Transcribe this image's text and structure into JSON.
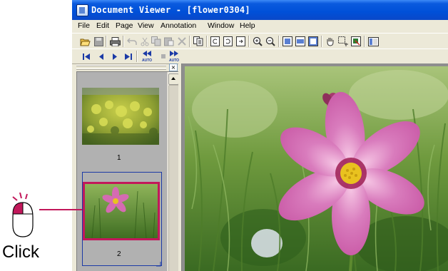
{
  "window": {
    "title": "Document Viewer - [flower0304]"
  },
  "menubar": {
    "items": [
      {
        "key": "file",
        "label": "File"
      },
      {
        "key": "edit",
        "label": "Edit"
      },
      {
        "key": "page",
        "label": "Page"
      },
      {
        "key": "view",
        "label": "View"
      },
      {
        "key": "annotation",
        "label": "Annotation"
      },
      {
        "key": "window",
        "label": "Window"
      },
      {
        "key": "help",
        "label": "Help"
      }
    ]
  },
  "toolbar": {
    "icons": [
      "open-folder-icon",
      "save-icon",
      "print-icon",
      "undo-icon",
      "cut-icon",
      "copy-icon",
      "paste-icon",
      "delete-icon",
      "copy-page-icon",
      "rotate-left-icon",
      "rotate-right-icon",
      "rotate-page-icon",
      "zoom-in-icon",
      "zoom-out-icon",
      "fit-page-icon",
      "fit-width-icon",
      "actual-size-icon",
      "hand-tool-icon",
      "select-area-icon",
      "export-icon",
      "thumbnails-toggle-icon"
    ]
  },
  "nav_toolbar": {
    "icons": [
      "first-page-icon",
      "previous-page-icon",
      "next-page-icon",
      "last-page-icon",
      "auto-rewind-icon",
      "stop-icon",
      "auto-play-icon"
    ],
    "auto_label": "AUTO"
  },
  "thumbnail_pane": {
    "close_glyph": "×",
    "pages": [
      {
        "number": "1",
        "selected": false
      },
      {
        "number": "2",
        "selected": true
      }
    ]
  },
  "callout": {
    "label": "Click"
  },
  "colors": {
    "title_bar": "#0a5ade",
    "selection_highlight": "#c2185b",
    "selection_frame": "#1b3aa6"
  }
}
